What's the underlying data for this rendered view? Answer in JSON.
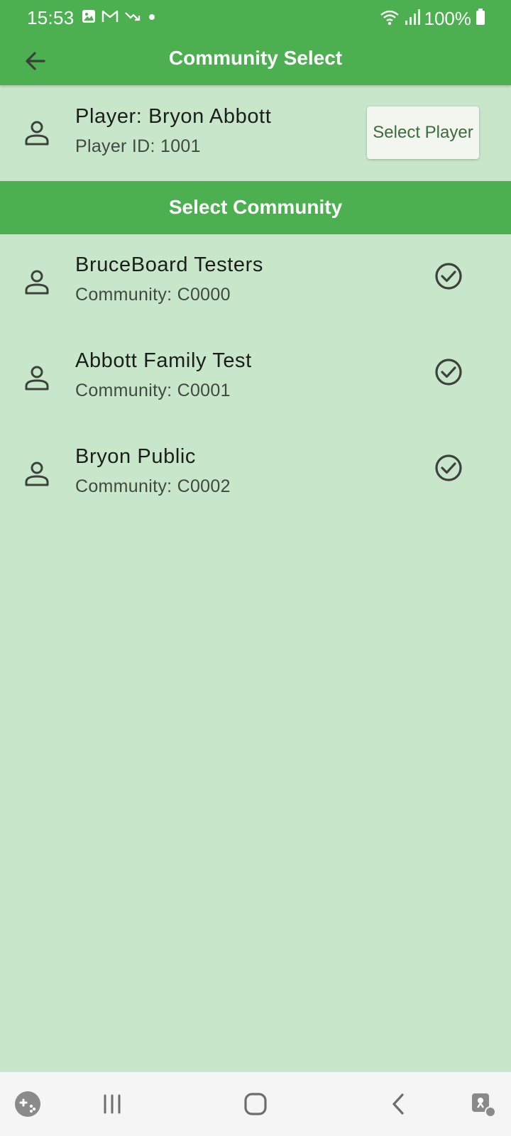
{
  "status_bar": {
    "time": "15:53",
    "battery": "100%",
    "left_icons": [
      "image-icon",
      "gmail-icon",
      "trend-down-icon",
      "dot-icon"
    ],
    "right_icons": [
      "wifi-icon",
      "signal-icon",
      "battery-icon"
    ]
  },
  "app_bar": {
    "title": "Community Select",
    "back_icon": "arrow-left-icon"
  },
  "player": {
    "name": "Player: Bryon Abbott",
    "id": "Player ID: 1001",
    "icon": "person-icon",
    "select_button": "Select Player"
  },
  "section": {
    "title": "Select Community"
  },
  "communities": [
    {
      "name": "BruceBoard Testers",
      "code": "Community: C0000",
      "icon": "person-icon",
      "status_icon": "check-circle-icon"
    },
    {
      "name": "Abbott Family Test",
      "code": "Community: C0001",
      "icon": "person-icon",
      "status_icon": "check-circle-icon"
    },
    {
      "name": "Bryon Public",
      "code": "Community: C0002",
      "icon": "person-icon",
      "status_icon": "check-circle-icon"
    }
  ],
  "nav_bar": {
    "icons": [
      "game-launcher-icon",
      "recent-apps-icon",
      "home-icon",
      "back-icon",
      "accessibility-icon"
    ]
  },
  "colors": {
    "primary": "#4caf50",
    "background": "#c8e6c9",
    "button": "#f3f6ee",
    "icon": "#3c423c"
  }
}
